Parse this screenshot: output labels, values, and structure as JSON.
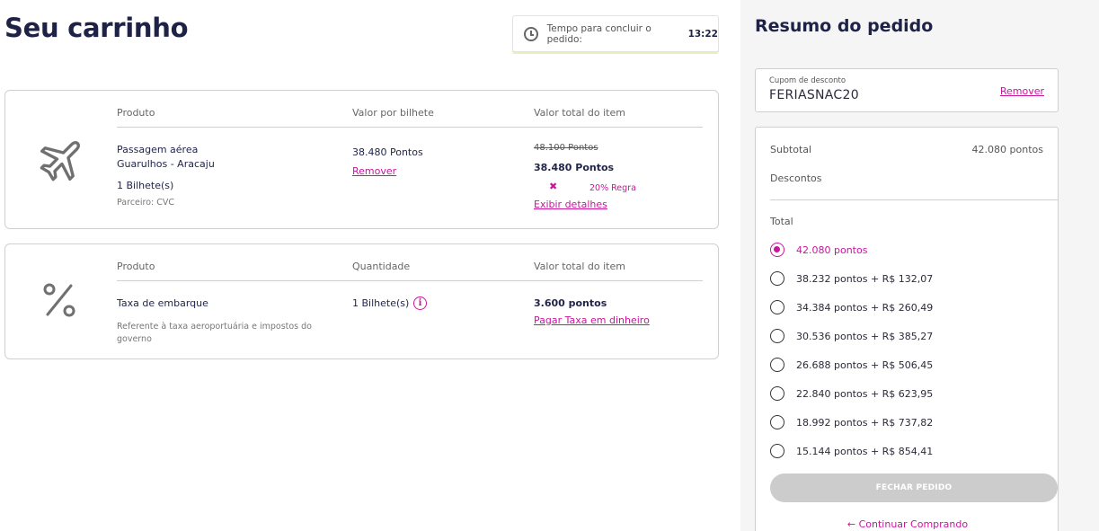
{
  "page": {
    "title": "Seu carrinho"
  },
  "timer": {
    "label": "Tempo para concluir o pedido:",
    "value": "13:22"
  },
  "cart_item_flight": {
    "headers": {
      "product": "Produto",
      "unit_value": "Valor por bilhete",
      "total": "Valor total do item"
    },
    "product_name": "Passagem aérea",
    "route": "Guarulhos - Aracaju",
    "tickets": "1 Bilhete(s)",
    "partner": "Parceiro: CVC",
    "unit_price": "38.480 Pontos",
    "remove_label": "Remover",
    "original_total": "48.100 Pontos",
    "total": "38.480 Pontos",
    "discount_rule": "20% Regra",
    "details_link": "Exibir detalhes",
    "icon": "airplane-icon"
  },
  "cart_item_fee": {
    "headers": {
      "product": "Produto",
      "quantity": "Quantidade",
      "total": "Valor total do item"
    },
    "product_name": "Taxa de embarque",
    "description_line1": "Referente à taxa aeroportuária e impostos do",
    "description_line2": "governo",
    "quantity": "1 Bilhete(s)",
    "total": "3.600 pontos",
    "pay_cash_link": "Pagar Taxa em dinheiro",
    "icon": "percent-icon"
  },
  "summary": {
    "title": "Resumo do pedido",
    "coupon": {
      "label": "Cupom de desconto",
      "value": "FERIASNAC20",
      "remove_label": "Remover"
    },
    "subtotal_label": "Subtotal",
    "subtotal_value": "42.080 pontos",
    "discounts_label": "Descontos",
    "total_label": "Total",
    "options": [
      {
        "label": "42.080 pontos",
        "selected": true
      },
      {
        "label": "38.232 pontos + R$ 132,07",
        "selected": false
      },
      {
        "label": "34.384 pontos + R$ 260,49",
        "selected": false
      },
      {
        "label": "30.536 pontos + R$ 385,27",
        "selected": false
      },
      {
        "label": "26.688 pontos + R$ 506,45",
        "selected": false
      },
      {
        "label": "22.840 pontos + R$ 623,95",
        "selected": false
      },
      {
        "label": "18.992 pontos + R$ 737,82",
        "selected": false
      },
      {
        "label": "15.144 pontos + R$ 854,41",
        "selected": false
      }
    ],
    "close_button": "FECHAR PEDIDO",
    "continue_link": "Continuar Comprando"
  },
  "colors": {
    "accent": "#c8159e",
    "title": "#1e2247",
    "disabled_button": "#cccccc"
  }
}
